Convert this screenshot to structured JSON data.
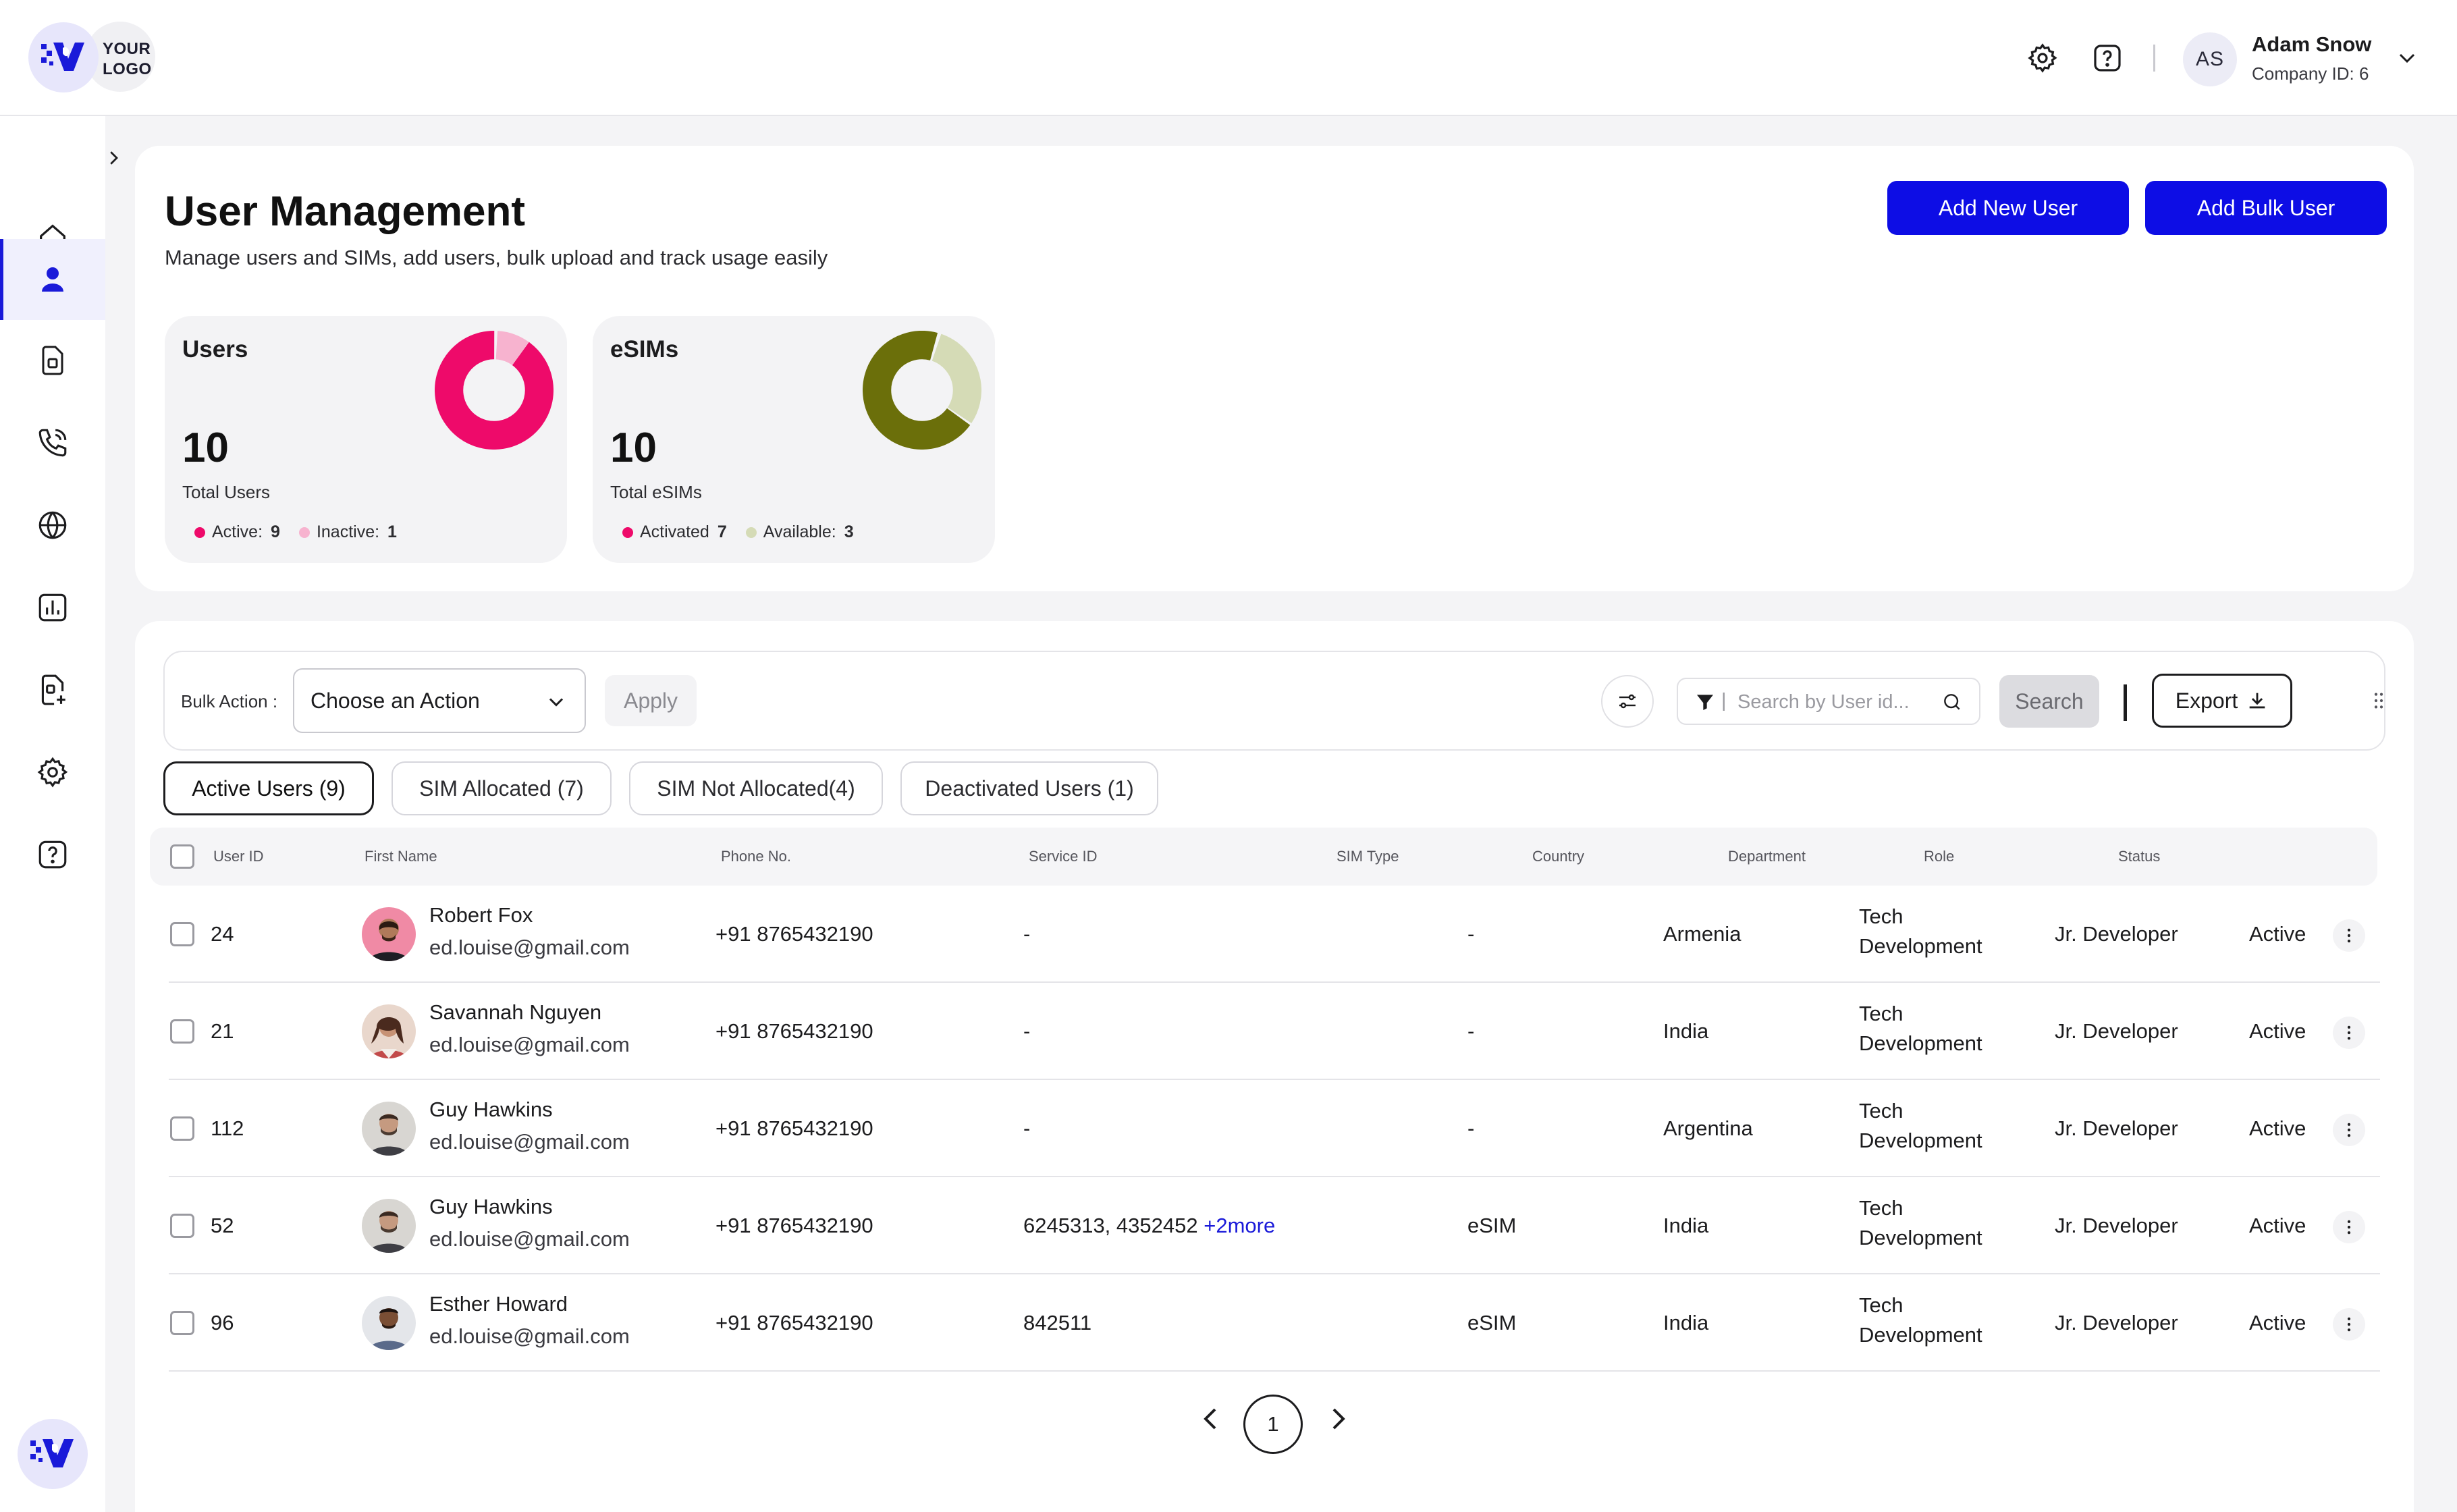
{
  "brand": {
    "logo_text_line1": "YOUR",
    "logo_text_line2": "LOGO",
    "accent": "#0d0de5"
  },
  "header": {
    "user_initials": "AS",
    "user_name": "Adam Snow",
    "company_id": "Company ID: 6",
    "icons": [
      "settings-icon",
      "help-icon",
      "chevron-down-icon"
    ]
  },
  "sidebar": {
    "items": [
      {
        "name": "home",
        "icon": "home-icon",
        "active": false
      },
      {
        "name": "users",
        "icon": "user-icon",
        "active": true
      },
      {
        "name": "sim",
        "icon": "sim-card-icon",
        "active": false
      },
      {
        "name": "calls",
        "icon": "phone-call-icon",
        "active": false
      },
      {
        "name": "roaming",
        "icon": "globe-phone-icon",
        "active": false
      },
      {
        "name": "reports",
        "icon": "bar-chart-icon",
        "active": false
      },
      {
        "name": "add-sim",
        "icon": "sim-add-icon",
        "active": false
      },
      {
        "name": "settings",
        "icon": "gear-icon",
        "active": false
      },
      {
        "name": "help",
        "icon": "help-icon",
        "active": false
      }
    ]
  },
  "page": {
    "title": "User Management",
    "subtitle": "Manage users and SIMs, add users, bulk upload and track usage easily",
    "add_new_user": "Add New User",
    "add_bulk_user": "Add Bulk User"
  },
  "stats": {
    "users": {
      "title": "Users",
      "value": "10",
      "sub": "Total Users",
      "legend": [
        {
          "label": "Active:",
          "value": "9",
          "color": "#ee0a6a"
        },
        {
          "label": "Inactive:",
          "value": "1",
          "color": "#f7b3cf"
        }
      ]
    },
    "esims": {
      "title": "eSIMs",
      "value": "10",
      "sub": "Total eSIMs",
      "legend": [
        {
          "label": "Activated",
          "value": "7",
          "color": "#6b6f0a"
        },
        {
          "label": "Available:",
          "value": "3",
          "color": "#d5dbb6"
        }
      ]
    }
  },
  "toolbar": {
    "bulk_label": "Bulk Action :",
    "select_value": "Choose an Action",
    "apply": "Apply",
    "search_placeholder": "Search by User id...",
    "search": "Search",
    "export": "Export"
  },
  "tabs": [
    {
      "label": "Active Users (9)",
      "active": true
    },
    {
      "label": "SIM Allocated (7)",
      "active": false
    },
    {
      "label": "SIM Not Allocated(4)",
      "active": false
    },
    {
      "label": "Deactivated Users (1)",
      "active": false
    }
  ],
  "table": {
    "columns": [
      "User ID",
      "First Name",
      "Phone No.",
      "Service ID",
      "SIM Type",
      "Country",
      "Department",
      "Role",
      "Status"
    ],
    "rows": [
      {
        "id": "24",
        "name": "Robert Fox",
        "email": "ed.louise@gmail.com",
        "phone": "+91 8765432190",
        "service": "-",
        "service_more": "",
        "sim": "-",
        "country": "Armenia",
        "dept1": "Tech",
        "dept2": "Development",
        "role": "Jr. Developer",
        "status": "Active"
      },
      {
        "id": "21",
        "name": "Savannah Nguyen",
        "email": "ed.louise@gmail.com",
        "phone": "+91 8765432190",
        "service": "-",
        "service_more": "",
        "sim": "-",
        "country": "India",
        "dept1": "Tech",
        "dept2": "Development",
        "role": "Jr. Developer",
        "status": "Active"
      },
      {
        "id": "112",
        "name": "Guy Hawkins",
        "email": "ed.louise@gmail.com",
        "phone": "+91 8765432190",
        "service": "-",
        "service_more": "",
        "sim": "-",
        "country": "Argentina",
        "dept1": "Tech",
        "dept2": "Development",
        "role": "Jr. Developer",
        "status": "Active"
      },
      {
        "id": "52",
        "name": "Guy Hawkins",
        "email": "ed.louise@gmail.com",
        "phone": "+91 8765432190",
        "service": "6245313, 4352452",
        "service_more": "+2more",
        "sim": "eSIM",
        "country": "India",
        "dept1": "Tech",
        "dept2": "Development",
        "role": "Jr. Developer",
        "status": "Active"
      },
      {
        "id": "96",
        "name": "Esther Howard",
        "email": "ed.louise@gmail.com",
        "phone": "+91 8765432190",
        "service": "842511",
        "service_more": "",
        "sim": "eSIM",
        "country": "India",
        "dept1": "Tech",
        "dept2": "Development",
        "role": "Jr. Developer",
        "status": "Active"
      }
    ]
  },
  "pagination": {
    "current": "1"
  }
}
